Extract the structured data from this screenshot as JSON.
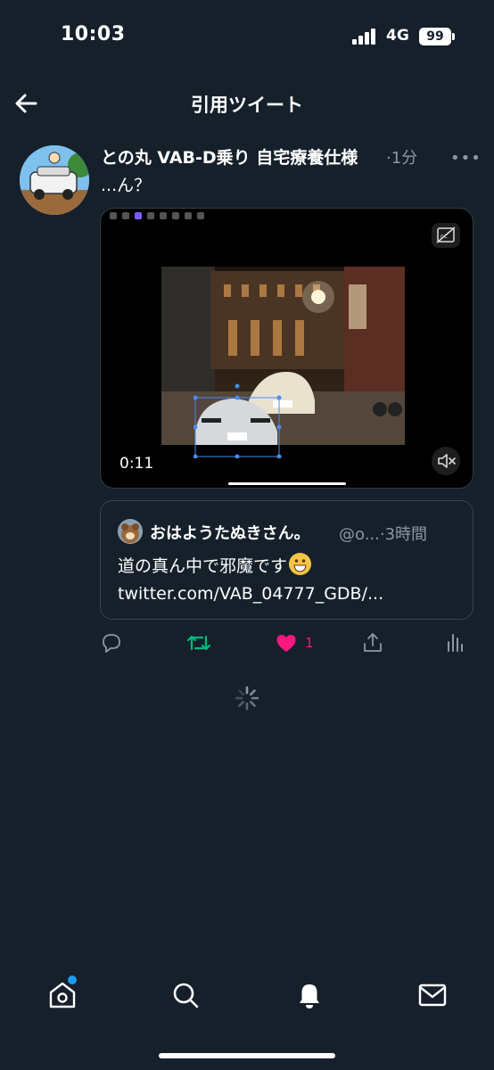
{
  "status_bar": {
    "time": "10:03",
    "network": "4G",
    "battery": "99"
  },
  "header": {
    "title": "引用ツイート"
  },
  "tweet": {
    "author": "との丸 VAB-D乗り 自宅療養仕様",
    "time": "·1分",
    "text": "...ん？",
    "media": {
      "duration": "0:11"
    }
  },
  "quoted_tweet": {
    "name": "おはようたぬきさん。",
    "handle_time": "@o...·3時間",
    "text_before_emoji": "道の真ん中で邪魔です",
    "text_after_emoji": " twitter.com/VAB_04777_GDB/..."
  },
  "actions": {
    "like_count": "1"
  },
  "colors": {
    "background": "#15202b",
    "retweet": "#00ba7c",
    "like": "#f91880",
    "muted_text": "#8b98a5",
    "accent": "#1d9bf0"
  },
  "icons": [
    "back-arrow-icon",
    "more-icon",
    "cc-icon",
    "mute-icon",
    "reply-icon",
    "retweet-icon",
    "heart-icon",
    "share-icon",
    "analytics-icon",
    "spinner-icon",
    "home-icon",
    "search-icon",
    "bell-icon",
    "mail-icon"
  ]
}
